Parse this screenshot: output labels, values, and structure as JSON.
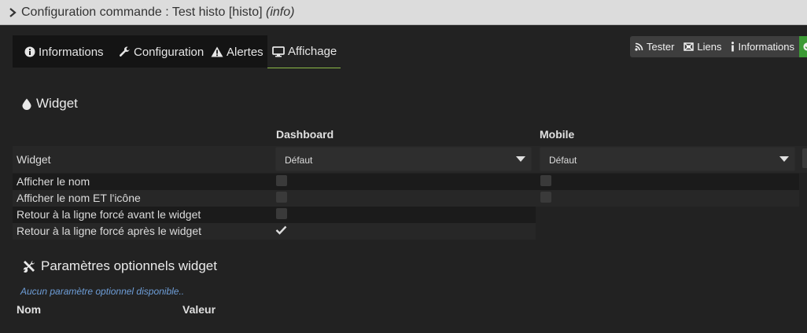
{
  "window": {
    "title": "Configuration commande : Test histo [histo]",
    "title_suffix": "(info)"
  },
  "tabs": [
    {
      "label": "Informations",
      "icon": "info-circle-icon",
      "active": false
    },
    {
      "label": "Configuration",
      "icon": "wrench-icon",
      "active": false
    },
    {
      "label": "Alertes",
      "icon": "warning-triangle-icon",
      "active": false
    },
    {
      "label": "Affichage",
      "icon": "monitor-icon",
      "active": true
    }
  ],
  "actions": {
    "tester_label": "Tester",
    "liens_label": "Liens",
    "informations_label": "Informations"
  },
  "widget_section": {
    "title": "Widget",
    "col_dashboard": "Dashboard",
    "col_mobile": "Mobile",
    "widget_label": "Widget",
    "dashboard_select_value": "Défaut",
    "mobile_select_value": "Défaut",
    "rows": [
      {
        "label": "Afficher le nom",
        "dashboard_checked": false,
        "mobile_checked": false
      },
      {
        "label": "Afficher le nom ET l'icône",
        "dashboard_checked": false,
        "mobile_checked": false
      },
      {
        "label": "Retour à la ligne forcé avant le widget",
        "dashboard_checked": false
      },
      {
        "label": "Retour à la ligne forcé après le widget",
        "dashboard_checked": true
      }
    ]
  },
  "optional_section": {
    "title": "Paramètres optionnels widget",
    "empty_text": "Aucun paramètre optionnel disponible..",
    "col_name": "Nom",
    "col_value": "Valeur"
  },
  "colors": {
    "accent_green": "#8dbb47",
    "save_green": "#3c9a35",
    "hint_blue": "#6e9ed8"
  }
}
